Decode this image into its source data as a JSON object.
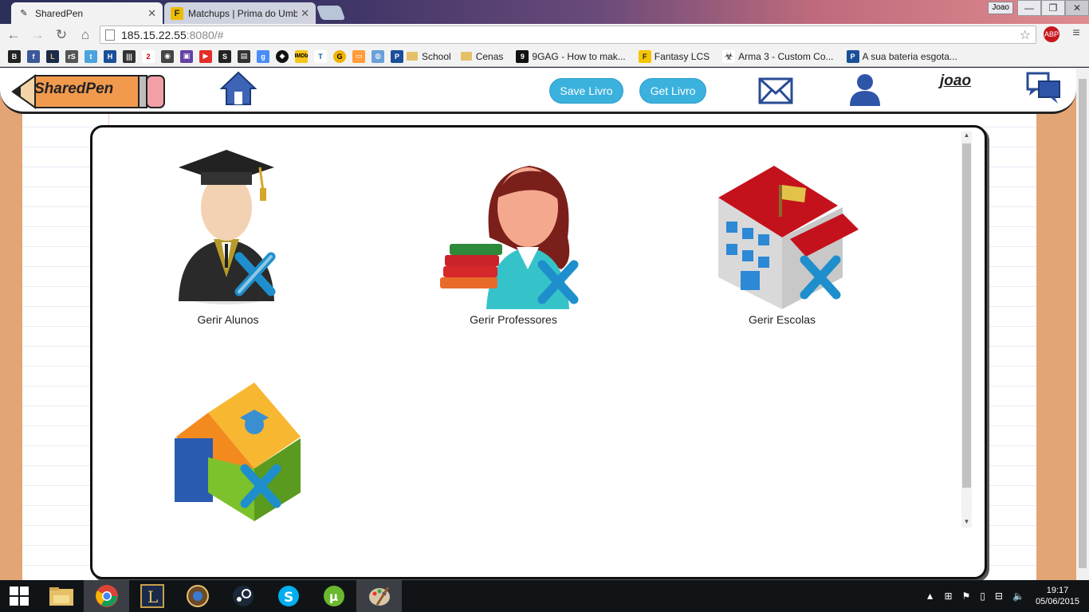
{
  "browser": {
    "tabs": [
      {
        "title": "SharedPen",
        "active": true
      },
      {
        "title": "Matchups | Prima do Umb",
        "active": false
      }
    ],
    "profile_name": "Joao",
    "url_host": "185.15.22.55",
    "url_rest": ":8080/#",
    "bookmarks": [
      {
        "label": "School",
        "type": "folder"
      },
      {
        "label": "Cenas",
        "type": "folder"
      },
      {
        "label": "9GAG - How to mak...",
        "type": "link"
      },
      {
        "label": "Fantasy LCS",
        "type": "link"
      },
      {
        "label": "Arma 3 - Custom Co...",
        "type": "link"
      },
      {
        "label": "A sua bateria esgota...",
        "type": "link"
      }
    ]
  },
  "site": {
    "logo_text": "SharedPen",
    "save_label": "Save Livro",
    "get_label": "Get Livro",
    "username": "joao"
  },
  "tiles": [
    {
      "label": "Gerir Alunos"
    },
    {
      "label": "Gerir Professores"
    },
    {
      "label": "Gerir Escolas"
    }
  ],
  "taskbar": {
    "time": "19:17",
    "date": "05/06/2015"
  }
}
